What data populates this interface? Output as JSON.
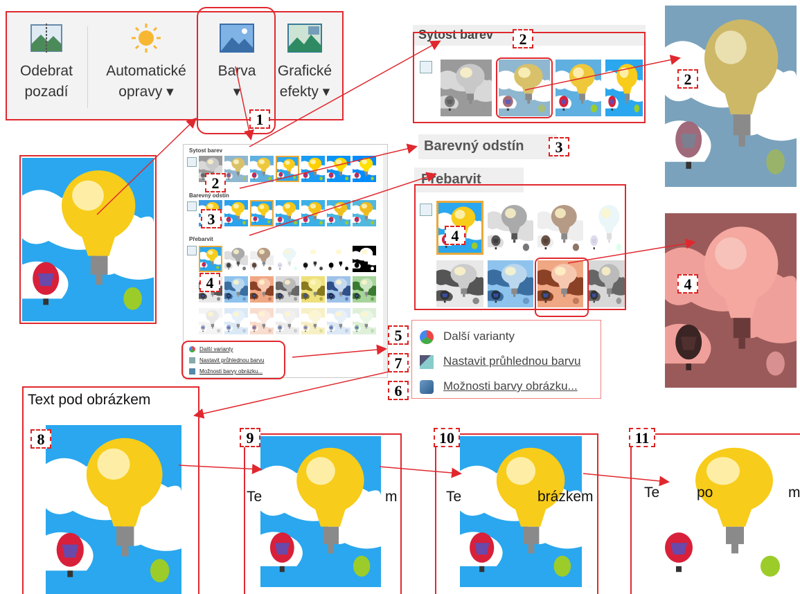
{
  "ribbon": {
    "remove_bg": [
      "Odebrat",
      "pozadí"
    ],
    "auto_corrections": [
      "Automatické",
      "opravy ▾"
    ],
    "color": [
      "Barva",
      "▾"
    ],
    "art_effects": [
      "Grafické",
      "efekty ▾"
    ]
  },
  "gallery": {
    "section_saturation": "Sytost barev",
    "section_tone": "Barevný odstín",
    "section_recolor": "Přebarvit",
    "more_variations": "Další varianty",
    "set_transparent": "Nastavit průhlednou barvu",
    "picture_color_options": "Možnosti barvy obrázku..."
  },
  "zoom": {
    "saturation_title": "Sytost barev",
    "tone_title": "Barevný odstín",
    "recolor_title": "Přebarvit",
    "more_variations": "Další varianty",
    "set_transparent": "Nastavit průhlednou barvu",
    "picture_color_options": "Možnosti barvy obrázku..."
  },
  "badges": [
    "1",
    "2",
    "2",
    "2",
    "3",
    "3",
    "4",
    "4",
    "4",
    "5",
    "6",
    "7",
    "8",
    "9",
    "10",
    "11"
  ],
  "wrap": {
    "caption": "Text pod obrázkem",
    "behind_text_9_left": "Te",
    "behind_text_9_right": "m",
    "behind_text_10_left": "Te",
    "behind_text_10_right": "brázkem",
    "behind_text_11_left": "Te",
    "behind_text_11_mid": "po",
    "behind_text_11_right": "m"
  },
  "colors": {
    "accent_red": "#e0282e",
    "sky_blue": "#2aa7ee",
    "bulb_yellow": "#f7cc1a"
  }
}
